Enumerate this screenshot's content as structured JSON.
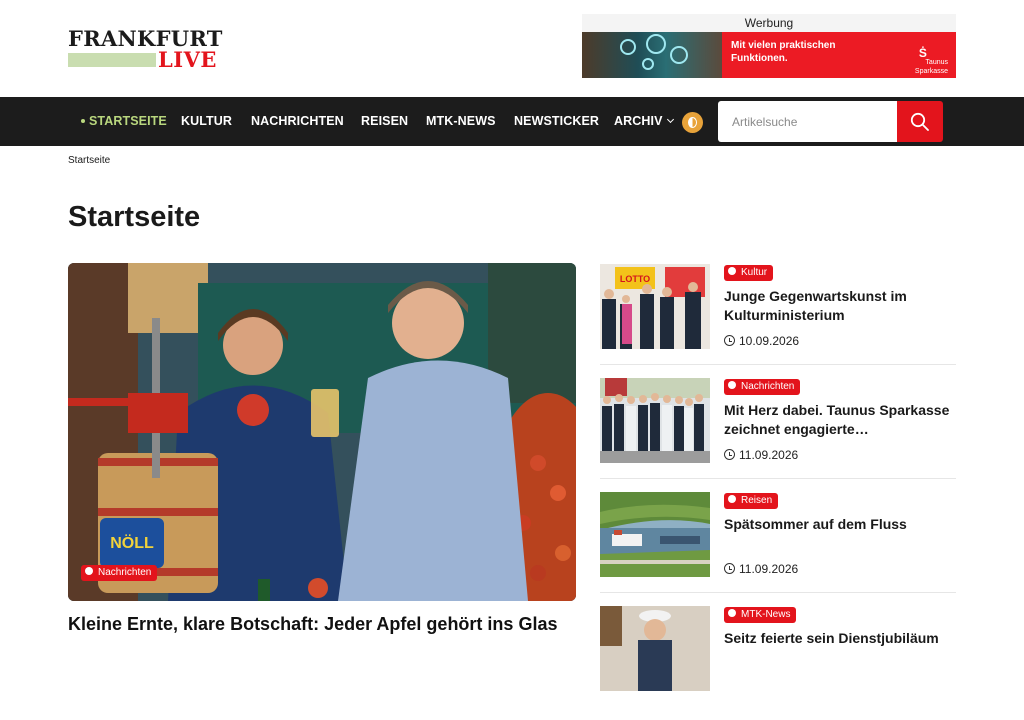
{
  "logo": {
    "line1": "FRANKFURT",
    "line2": "LIVE"
  },
  "ad": {
    "label": "Werbung",
    "text": "Mit vielen praktischen Funktionen.",
    "brand_line1": "Taunus",
    "brand_line2": "Sparkasse"
  },
  "nav": {
    "items": [
      {
        "label": "STARTSEITE",
        "active": true
      },
      {
        "label": "KULTUR"
      },
      {
        "label": "NACHRICHTEN"
      },
      {
        "label": "REISEN"
      },
      {
        "label": "MTK-NEWS"
      },
      {
        "label": "NEWSTICKER"
      },
      {
        "label": "ARCHIV"
      }
    ],
    "search_placeholder": "Artikelsuche"
  },
  "breadcrumb": "Startseite",
  "page_title": "Startseite",
  "hero": {
    "category": "Nachrichten",
    "caption": "Kleine Ernte, klare Botschaft: Jeder Apfel gehört ins Glas",
    "press_label": "NÖLL"
  },
  "articles": [
    {
      "category": "Kultur",
      "title": "Junge Gegenwartskunst im Kulturministerium",
      "date": "10.09.2026",
      "thumb_text": "LOTTO"
    },
    {
      "category": "Nachrichten",
      "title": "Mit Herz dabei. Taunus Sparkasse zeichnet engagierte…",
      "date": "11.09.2026"
    },
    {
      "category": "Reisen",
      "title": "Spätsommer auf dem Fluss",
      "date": "11.09.2026"
    },
    {
      "category": "MTK-News",
      "title": "Seitz feierte sein Dienstjubiläum"
    }
  ],
  "colors": {
    "accent_red": "#e3141c",
    "nav_bg": "#1c1c1c",
    "nav_active": "#b9d77e",
    "theme_toggle": "#e8a33a"
  }
}
